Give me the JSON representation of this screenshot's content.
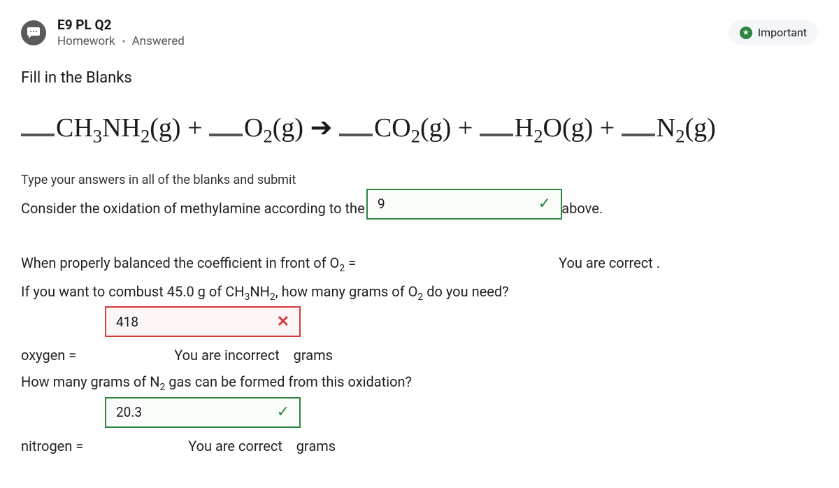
{
  "header": {
    "title": "E9 PL Q2",
    "category": "Homework",
    "status": "Answered",
    "important_label": "Important"
  },
  "section_label": "Fill in the Blanks",
  "equation_html": "<span class='blank'></span>CH<sub>3</sub>NH<sub>2</sub>(g) + <span class='blank'></span>O<sub>2</sub>(g) ➔ <span class='blank'></span>CO<sub>2</sub>(g) + <span class='blank'></span>H<sub>2</sub>O(g) + <span class='blank'></span>N<sub>2</sub>(g)",
  "instructions": "Type your answers in all of the blanks and submit",
  "prompt_html": "Consider the oxidation of methylamine according to the <u>unbalanced</u> chemical equation above.",
  "q1": {
    "pre_html": "When properly balanced the coefficient in front of O<sub>2</sub> = ",
    "value": "9",
    "feedback": "You are correct",
    "post": "."
  },
  "q2": {
    "pre_html": "If you want to combust 45.0 g of CH<sub>3</sub>NH<sub>2</sub>, how many grams of O<sub>2</sub> do you need?",
    "label": "oxygen = ",
    "value": "418",
    "feedback": "You are incorrect",
    "unit": "grams"
  },
  "q3": {
    "pre_html": "How many grams of N<sub>2</sub> gas can be formed from this oxidation?",
    "label": "nitrogen = ",
    "value": "20.3",
    "feedback": "You are correct",
    "unit": "grams"
  }
}
